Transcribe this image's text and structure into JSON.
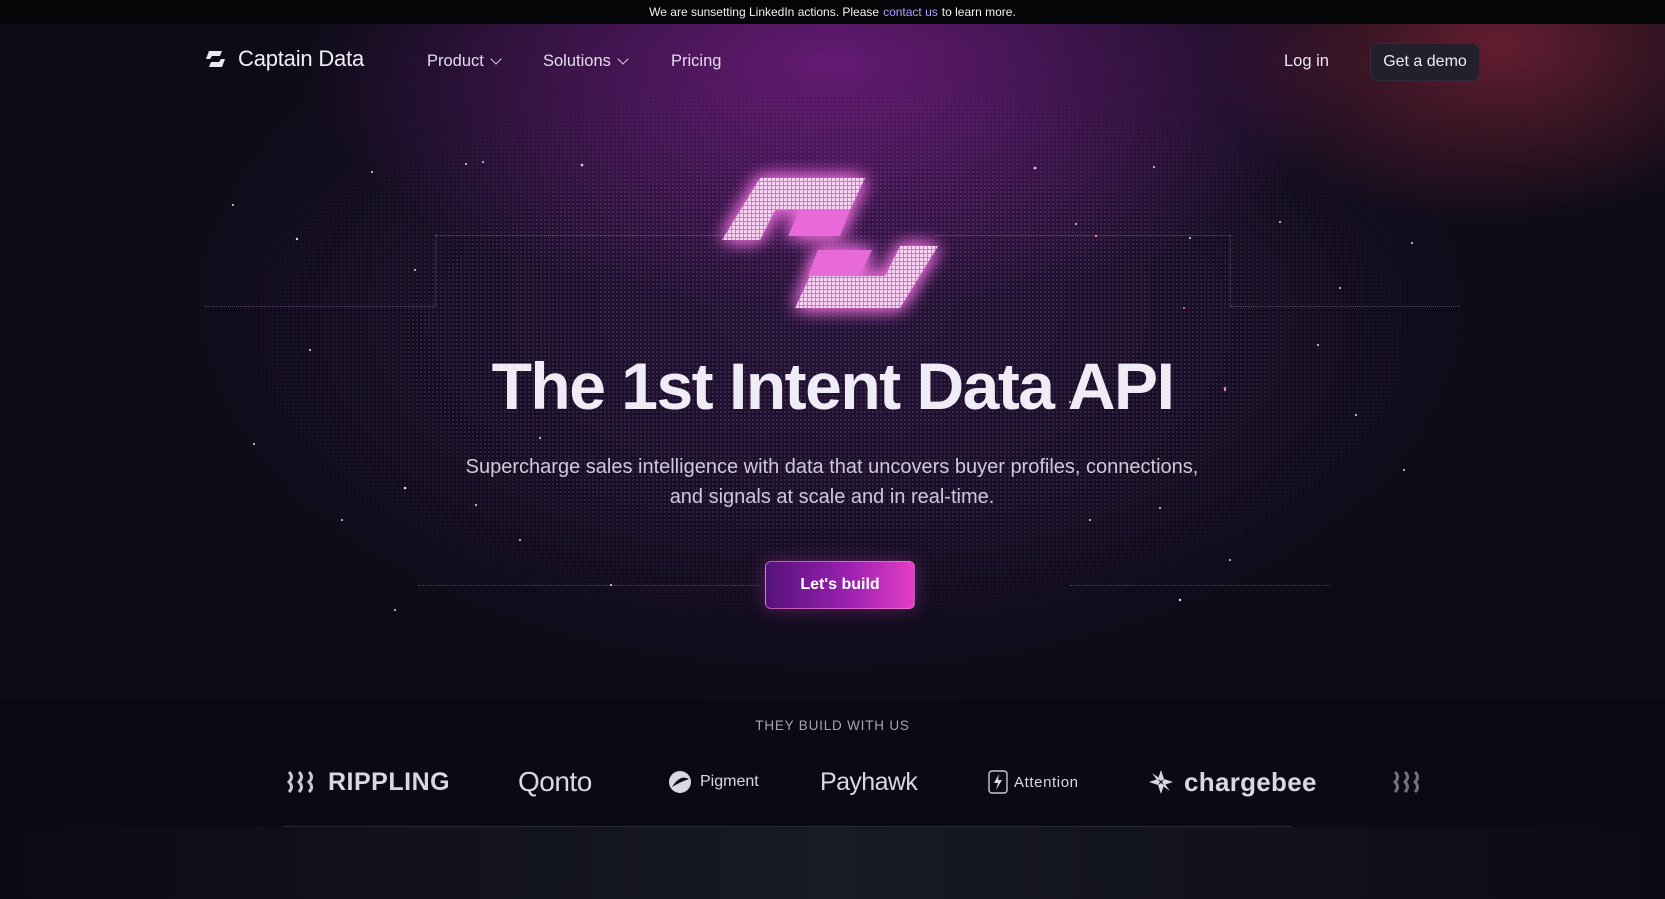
{
  "banner": {
    "text_before": "We are sunsetting LinkedIn actions. Please",
    "link": "contact us",
    "text_after": "to learn more."
  },
  "nav": {
    "brand": "Captain Data",
    "items": [
      {
        "label": "Product",
        "has_dropdown": true
      },
      {
        "label": "Solutions",
        "has_dropdown": true
      },
      {
        "label": "Pricing",
        "has_dropdown": false
      }
    ],
    "login": "Log in",
    "demo": "Get a demo"
  },
  "hero": {
    "headline": "The 1st Intent Data API",
    "subtitle_line1": "Supercharge sales intelligence with data that uncovers buyer profiles, connections,",
    "subtitle_line2": "and signals at scale and in real-time.",
    "cta": "Let's build"
  },
  "customers": {
    "heading": "THEY BUILD WITH US",
    "logos": [
      "RIPPLING",
      "Qonto",
      "Pigment",
      "Payhawk",
      "Attention",
      "chargebee"
    ]
  },
  "colors": {
    "background": "#0c0b16",
    "accent_pink": "#e23ec4",
    "accent_purple": "#54127a",
    "link": "#a9a4ff"
  },
  "icons": [
    "captain-data-logo-icon",
    "chevron-down-icon",
    "captain-data-hero-icon",
    "rippling-icon",
    "pigment-icon",
    "attention-icon",
    "chargebee-icon"
  ]
}
